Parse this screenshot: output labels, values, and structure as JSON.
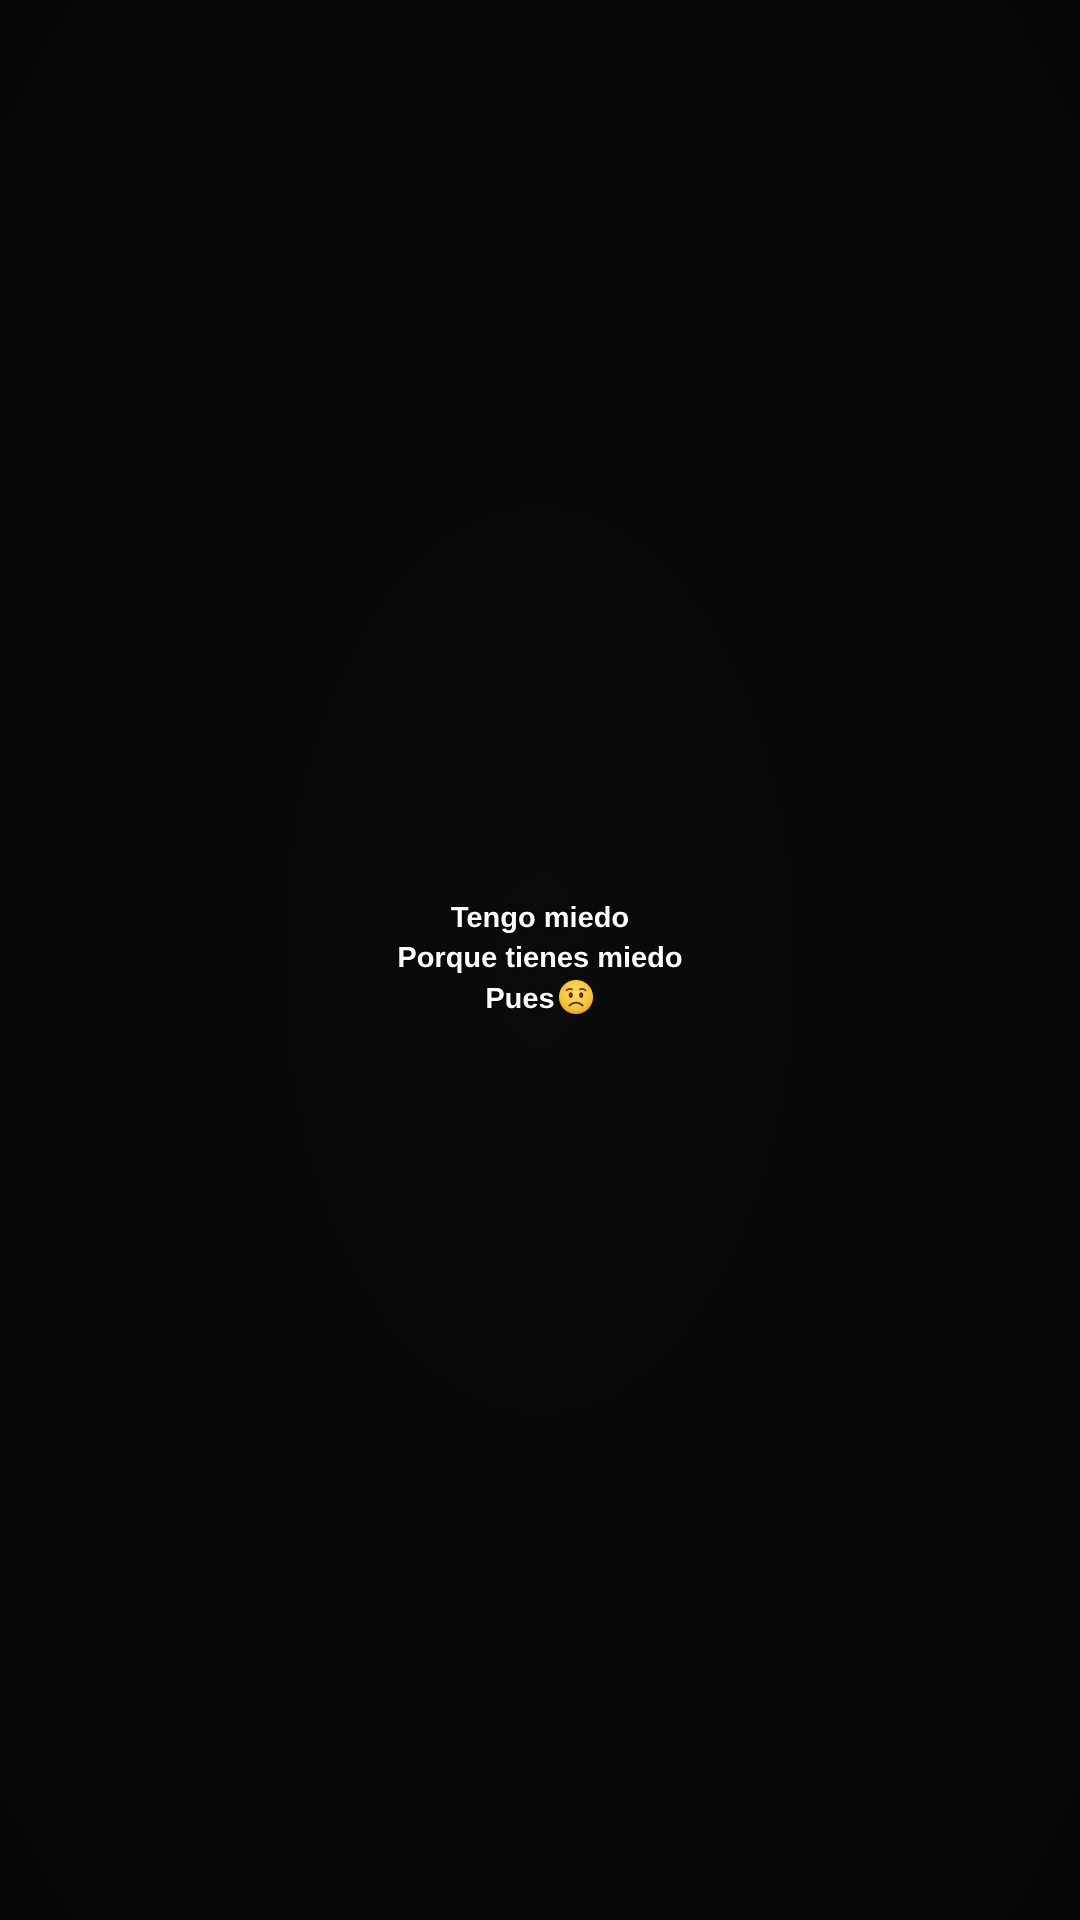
{
  "story": {
    "background_color": "#060606",
    "text_color": "#ffffff",
    "lines": [
      "Tengo miedo",
      "Porque tienes miedo",
      "Pues"
    ],
    "trailing_emoji": {
      "name": "worried-face-icon",
      "color": "#f5c33b"
    }
  }
}
